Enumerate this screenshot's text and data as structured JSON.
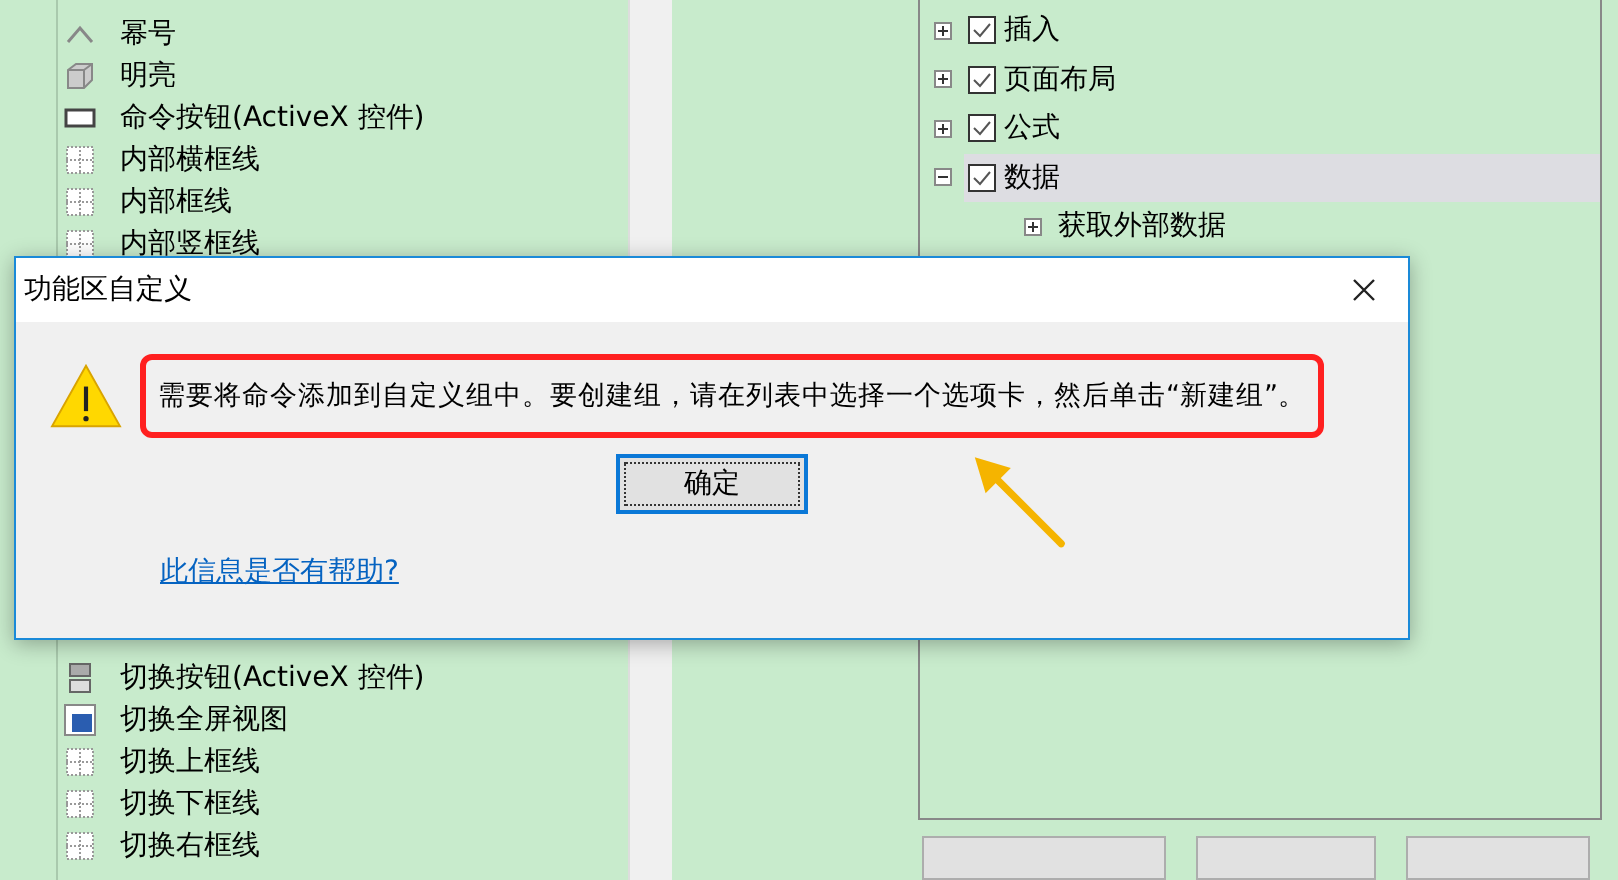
{
  "command_list": {
    "items_above": [
      {
        "label": "幂号",
        "kind": "caret"
      },
      {
        "label": "明亮",
        "kind": "cube"
      },
      {
        "label": "命令按钮(ActiveX 控件)",
        "kind": "button"
      },
      {
        "label": "内部横框线",
        "kind": "grid"
      },
      {
        "label": "内部框线",
        "kind": "grid"
      },
      {
        "label": "内部竖框线",
        "kind": "grid"
      }
    ],
    "items_below": [
      {
        "label": "切换按钮(ActiveX 控件)",
        "kind": "toggle"
      },
      {
        "label": "切换全屏视图",
        "kind": "screen"
      },
      {
        "label": "切换上框线",
        "kind": "grid"
      },
      {
        "label": "切换下框线",
        "kind": "grid"
      },
      {
        "label": "切换右框线",
        "kind": "grid"
      }
    ]
  },
  "tab_tree": {
    "items": [
      {
        "label": "插入",
        "checked": true,
        "expanded": false,
        "selected": false
      },
      {
        "label": "页面布局",
        "checked": true,
        "expanded": false,
        "selected": false
      },
      {
        "label": "公式",
        "checked": true,
        "expanded": false,
        "selected": false
      },
      {
        "label": "数据",
        "checked": true,
        "expanded": true,
        "selected": true,
        "children": [
          {
            "label": "获取外部数据",
            "expanded": false
          }
        ]
      }
    ]
  },
  "dialog": {
    "title": "功能区自定义",
    "message": "需要将命令添加到自定义组中。要创建组，请在列表中选择一个选项卡，然后单击“新建组”。",
    "ok_button": "确定",
    "help_link": "此信息是否有帮助?"
  }
}
